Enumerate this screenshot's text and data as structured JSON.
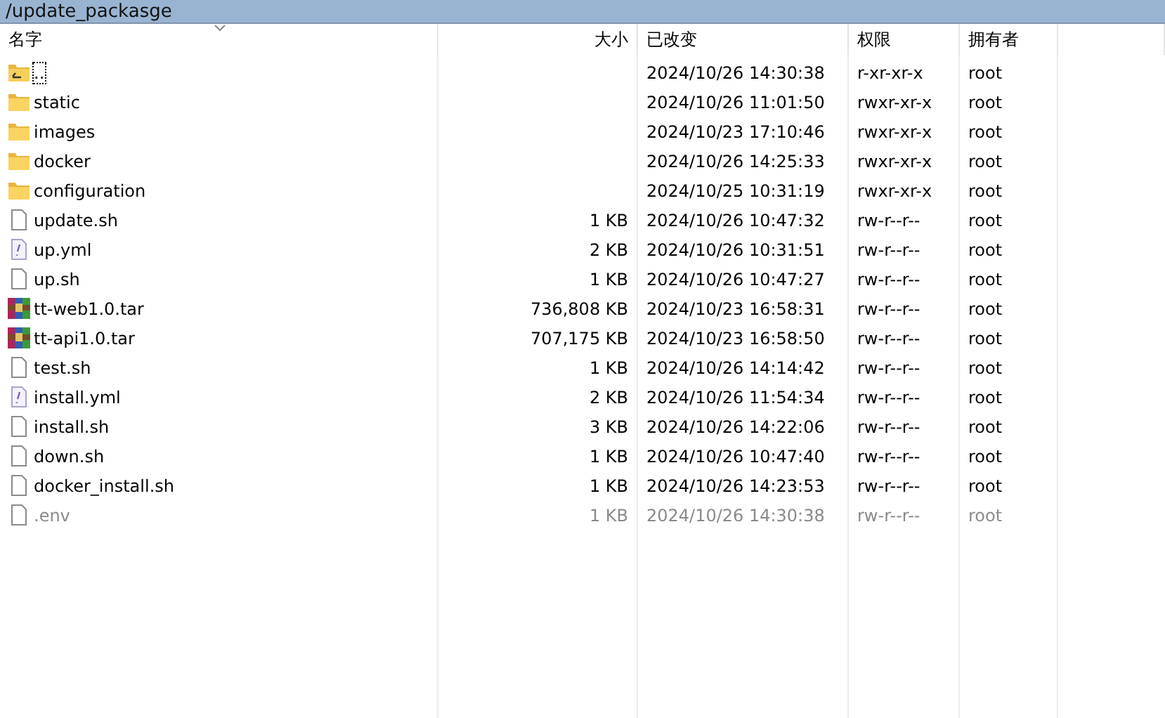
{
  "path_bar": {
    "path": "/update_packasge"
  },
  "columns": [
    {
      "label": "名字",
      "sorted": true
    },
    {
      "label": "大小",
      "sorted": false
    },
    {
      "label": "已改变",
      "sorted": false
    },
    {
      "label": "权限",
      "sorted": false
    },
    {
      "label": "拥有者",
      "sorted": false
    }
  ],
  "files": [
    {
      "kind": "parent",
      "name": "..",
      "modified": "2024/10/26 14:30:38",
      "permissions": "r-xr-xr-x",
      "owner": "root",
      "focused": true,
      "hidden": false
    },
    {
      "kind": "folder",
      "name": "static",
      "modified": "2024/10/26 11:01:50",
      "permissions": "rwxr-xr-x",
      "owner": "root",
      "focused": false,
      "hidden": false
    },
    {
      "kind": "folder",
      "name": "images",
      "modified": "2024/10/23 17:10:46",
      "permissions": "rwxr-xr-x",
      "owner": "root",
      "focused": false,
      "hidden": false
    },
    {
      "kind": "folder",
      "name": "docker",
      "modified": "2024/10/26 14:25:33",
      "permissions": "rwxr-xr-x",
      "owner": "root",
      "focused": false,
      "hidden": false
    },
    {
      "kind": "folder",
      "name": "configuration",
      "modified": "2024/10/25 10:31:19",
      "permissions": "rwxr-xr-x",
      "owner": "root",
      "focused": false,
      "hidden": false
    },
    {
      "kind": "file",
      "name": "update.sh",
      "size": "1 KB",
      "modified": "2024/10/26 10:47:32",
      "permissions": "rw-r--r--",
      "owner": "root",
      "focused": false,
      "hidden": false
    },
    {
      "kind": "yml",
      "name": "up.yml",
      "size": "2 KB",
      "modified": "2024/10/26 10:31:51",
      "permissions": "rw-r--r--",
      "owner": "root",
      "focused": false,
      "hidden": false
    },
    {
      "kind": "file",
      "name": "up.sh",
      "size": "1 KB",
      "modified": "2024/10/26 10:47:27",
      "permissions": "rw-r--r--",
      "owner": "root",
      "focused": false,
      "hidden": false
    },
    {
      "kind": "archive",
      "name": "tt-web1.0.tar",
      "size": "736,808 KB",
      "modified": "2024/10/23 16:58:31",
      "permissions": "rw-r--r--",
      "owner": "root",
      "focused": false,
      "hidden": false
    },
    {
      "kind": "archive",
      "name": "tt-api1.0.tar",
      "size": "707,175 KB",
      "modified": "2024/10/23 16:58:50",
      "permissions": "rw-r--r--",
      "owner": "root",
      "focused": false,
      "hidden": false
    },
    {
      "kind": "file",
      "name": "test.sh",
      "size": "1 KB",
      "modified": "2024/10/26 14:14:42",
      "permissions": "rw-r--r--",
      "owner": "root",
      "focused": false,
      "hidden": false
    },
    {
      "kind": "yml",
      "name": "install.yml",
      "size": "2 KB",
      "modified": "2024/10/26 11:54:34",
      "permissions": "rw-r--r--",
      "owner": "root",
      "focused": false,
      "hidden": false
    },
    {
      "kind": "file",
      "name": "install.sh",
      "size": "3 KB",
      "modified": "2024/10/26 14:22:06",
      "permissions": "rw-r--r--",
      "owner": "root",
      "focused": false,
      "hidden": false
    },
    {
      "kind": "file",
      "name": "down.sh",
      "size": "1 KB",
      "modified": "2024/10/26 10:47:40",
      "permissions": "rw-r--r--",
      "owner": "root",
      "focused": false,
      "hidden": false
    },
    {
      "kind": "file",
      "name": "docker_install.sh",
      "size": "1 KB",
      "modified": "2024/10/26 14:23:53",
      "permissions": "rw-r--r--",
      "owner": "root",
      "focused": false,
      "hidden": false
    },
    {
      "kind": "file",
      "name": ".env",
      "size": "1 KB",
      "modified": "2024/10/26 14:30:38",
      "permissions": "rw-r--r--",
      "owner": "root",
      "focused": false,
      "hidden": true
    }
  ]
}
